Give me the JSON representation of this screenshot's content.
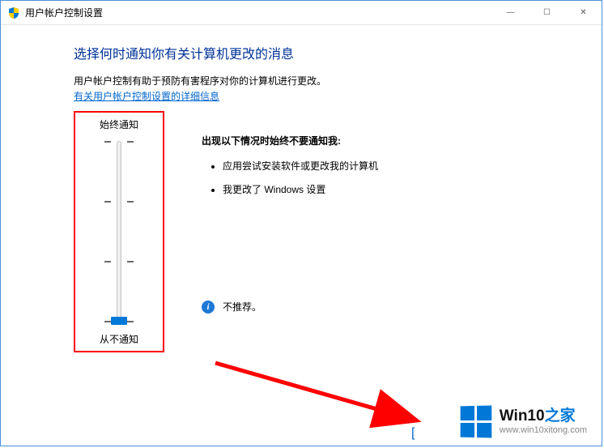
{
  "titlebar": {
    "title": "用户帐户控制设置"
  },
  "window_buttons": {
    "min": "—",
    "max": "☐",
    "close": "✕"
  },
  "heading": "选择何时通知你有关计算机更改的消息",
  "description": "用户帐户控制有助于预防有害程序对你的计算机进行更改。",
  "link": "有关用户帐户控制设置的详细信息",
  "slider": {
    "top_label": "始终通知",
    "bottom_label": "从不通知",
    "levels": 4,
    "current_level": 3
  },
  "detail": {
    "heading": "出现以下情况时始终不要通知我:",
    "bullets": [
      "应用尝试安装软件或更改我的计算机",
      "我更改了 Windows 设置"
    ],
    "recommendation": "不推荐。"
  },
  "brand": {
    "line1a": "Win10",
    "line1b": "之家",
    "url": "www.win10xitong.com"
  },
  "scrap": "["
}
